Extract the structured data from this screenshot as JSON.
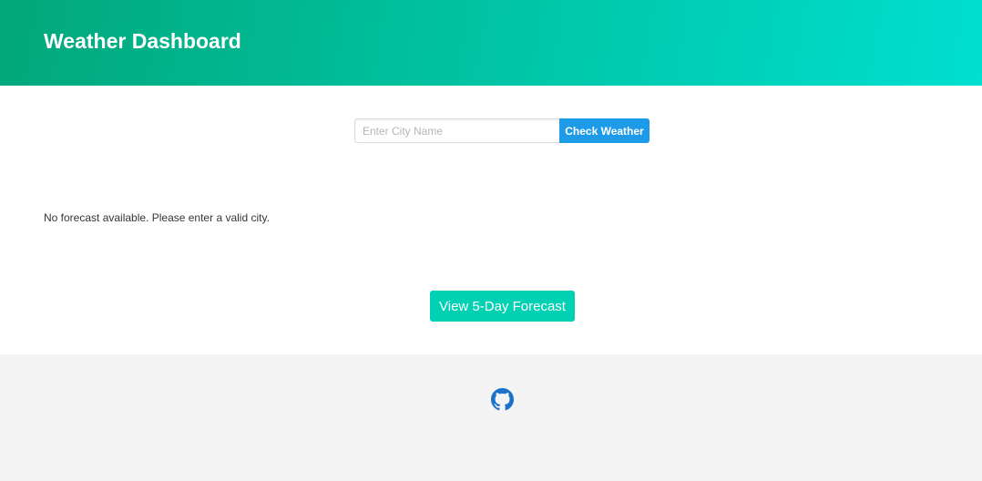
{
  "header": {
    "title": "Weather Dashboard"
  },
  "search": {
    "placeholder": "Enter City Name",
    "value": "",
    "button_label": "Check Weather"
  },
  "forecast": {
    "message": "No forecast available. Please enter a valid city.",
    "button_label": "View 5-Day Forecast"
  },
  "footer": {
    "icon": "github-icon"
  },
  "colors": {
    "hero_gradient_start": "#02a77a",
    "hero_gradient_end": "#00dfd0",
    "check_button": "#1e9be8",
    "forecast_button": "#00d1b2",
    "github_icon": "#1a73c9",
    "footer_bg": "#f4f4f4"
  }
}
